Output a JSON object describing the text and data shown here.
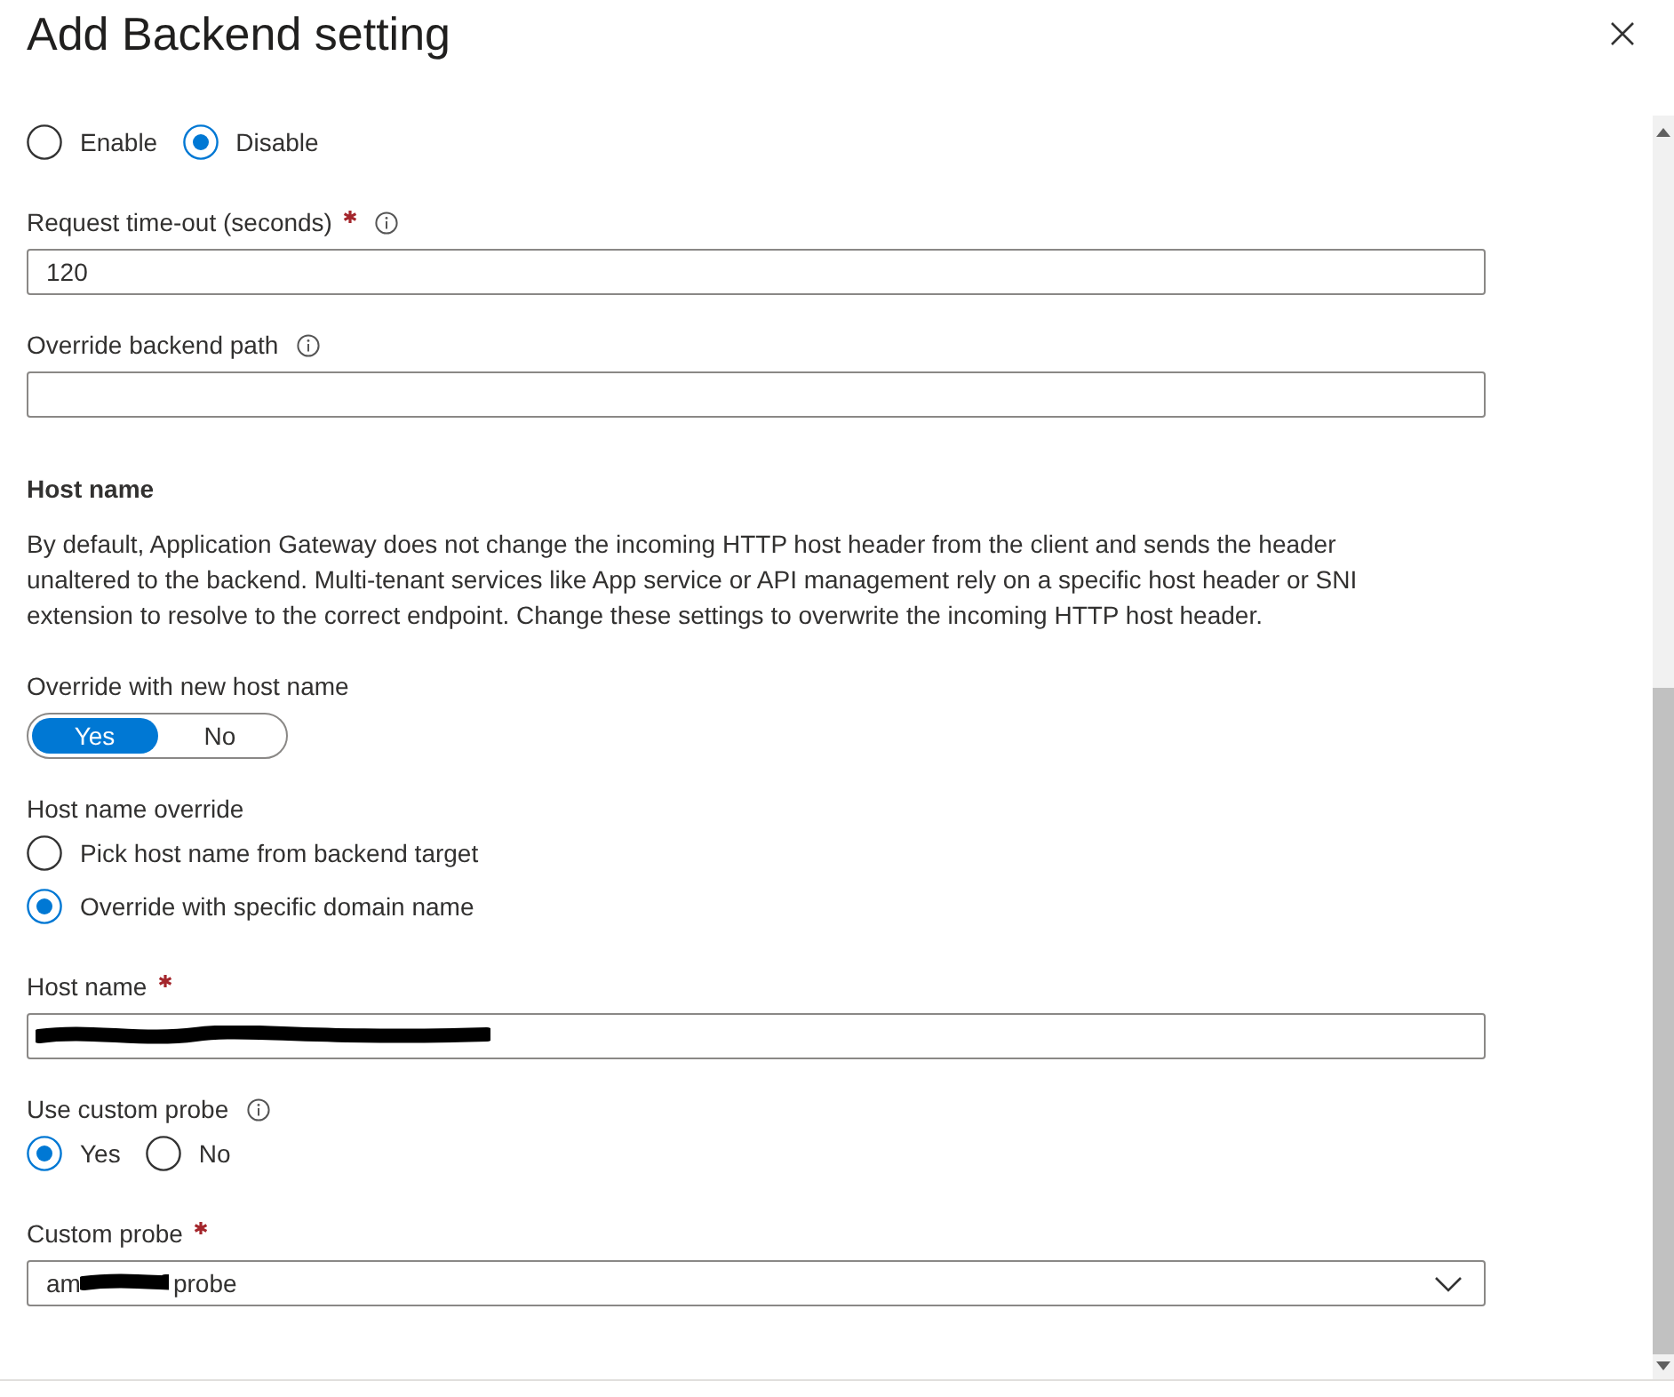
{
  "panel": {
    "title": "Add Backend setting"
  },
  "form": [
    {
      "kind": "radio_row",
      "options": [
        {
          "label": "Enable",
          "selected": false
        },
        {
          "label": "Disable",
          "selected": true
        }
      ]
    },
    {
      "kind": "text",
      "label": "Request time-out (seconds)",
      "required": true,
      "info": true,
      "value": "120"
    },
    {
      "kind": "text",
      "label": "Override backend path",
      "required": false,
      "info": true
    },
    {
      "kind": "heading",
      "text": "Host name"
    },
    {
      "kind": "paragraph",
      "text": "By default, Application Gateway does not change the incoming HTTP host header from the client and sends the header unaltered to the backend. Multi-tenant services like App service or API management rely on a specific host header or SNI extension to resolve to the correct endpoint. Change these settings to overwrite the incoming HTTP host header."
    },
    {
      "kind": "toggle",
      "label": "Override with new host name",
      "options": [
        {
          "label": "Yes",
          "selected": true
        },
        {
          "label": "No",
          "selected": false
        }
      ]
    },
    {
      "kind": "radio_list",
      "label": "Host name override",
      "options": [
        {
          "label": "Pick host name from backend target",
          "selected": false
        },
        {
          "label": "Override with specific domain name",
          "selected": true
        }
      ]
    },
    {
      "kind": "text",
      "label": "Host name",
      "required": true,
      "info": false,
      "redacted": true
    },
    {
      "kind": "radio_row",
      "label": "Use custom probe",
      "info": true,
      "options": [
        {
          "label": "Yes",
          "selected": true
        },
        {
          "label": "No",
          "selected": false
        }
      ]
    },
    {
      "kind": "select",
      "label": "Custom probe",
      "required": true,
      "info": false,
      "redacted": true,
      "value_parts": [
        "am",
        "probe"
      ]
    }
  ]
}
